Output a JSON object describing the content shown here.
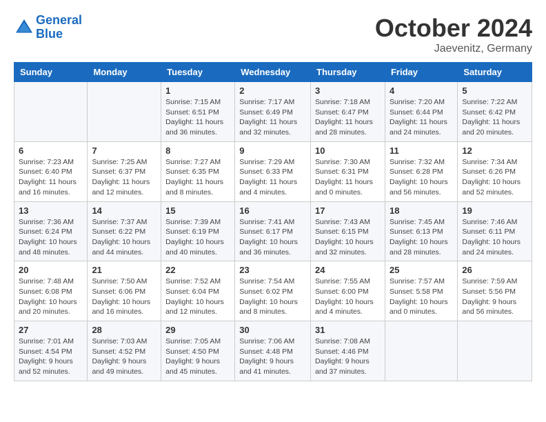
{
  "header": {
    "logo_line1": "General",
    "logo_line2": "Blue",
    "month": "October 2024",
    "location": "Jaevenitz, Germany"
  },
  "weekdays": [
    "Sunday",
    "Monday",
    "Tuesday",
    "Wednesday",
    "Thursday",
    "Friday",
    "Saturday"
  ],
  "weeks": [
    [
      {
        "day": "",
        "sunrise": "",
        "sunset": "",
        "daylight": ""
      },
      {
        "day": "",
        "sunrise": "",
        "sunset": "",
        "daylight": ""
      },
      {
        "day": "1",
        "sunrise": "Sunrise: 7:15 AM",
        "sunset": "Sunset: 6:51 PM",
        "daylight": "Daylight: 11 hours and 36 minutes."
      },
      {
        "day": "2",
        "sunrise": "Sunrise: 7:17 AM",
        "sunset": "Sunset: 6:49 PM",
        "daylight": "Daylight: 11 hours and 32 minutes."
      },
      {
        "day": "3",
        "sunrise": "Sunrise: 7:18 AM",
        "sunset": "Sunset: 6:47 PM",
        "daylight": "Daylight: 11 hours and 28 minutes."
      },
      {
        "day": "4",
        "sunrise": "Sunrise: 7:20 AM",
        "sunset": "Sunset: 6:44 PM",
        "daylight": "Daylight: 11 hours and 24 minutes."
      },
      {
        "day": "5",
        "sunrise": "Sunrise: 7:22 AM",
        "sunset": "Sunset: 6:42 PM",
        "daylight": "Daylight: 11 hours and 20 minutes."
      }
    ],
    [
      {
        "day": "6",
        "sunrise": "Sunrise: 7:23 AM",
        "sunset": "Sunset: 6:40 PM",
        "daylight": "Daylight: 11 hours and 16 minutes."
      },
      {
        "day": "7",
        "sunrise": "Sunrise: 7:25 AM",
        "sunset": "Sunset: 6:37 PM",
        "daylight": "Daylight: 11 hours and 12 minutes."
      },
      {
        "day": "8",
        "sunrise": "Sunrise: 7:27 AM",
        "sunset": "Sunset: 6:35 PM",
        "daylight": "Daylight: 11 hours and 8 minutes."
      },
      {
        "day": "9",
        "sunrise": "Sunrise: 7:29 AM",
        "sunset": "Sunset: 6:33 PM",
        "daylight": "Daylight: 11 hours and 4 minutes."
      },
      {
        "day": "10",
        "sunrise": "Sunrise: 7:30 AM",
        "sunset": "Sunset: 6:31 PM",
        "daylight": "Daylight: 11 hours and 0 minutes."
      },
      {
        "day": "11",
        "sunrise": "Sunrise: 7:32 AM",
        "sunset": "Sunset: 6:28 PM",
        "daylight": "Daylight: 10 hours and 56 minutes."
      },
      {
        "day": "12",
        "sunrise": "Sunrise: 7:34 AM",
        "sunset": "Sunset: 6:26 PM",
        "daylight": "Daylight: 10 hours and 52 minutes."
      }
    ],
    [
      {
        "day": "13",
        "sunrise": "Sunrise: 7:36 AM",
        "sunset": "Sunset: 6:24 PM",
        "daylight": "Daylight: 10 hours and 48 minutes."
      },
      {
        "day": "14",
        "sunrise": "Sunrise: 7:37 AM",
        "sunset": "Sunset: 6:22 PM",
        "daylight": "Daylight: 10 hours and 44 minutes."
      },
      {
        "day": "15",
        "sunrise": "Sunrise: 7:39 AM",
        "sunset": "Sunset: 6:19 PM",
        "daylight": "Daylight: 10 hours and 40 minutes."
      },
      {
        "day": "16",
        "sunrise": "Sunrise: 7:41 AM",
        "sunset": "Sunset: 6:17 PM",
        "daylight": "Daylight: 10 hours and 36 minutes."
      },
      {
        "day": "17",
        "sunrise": "Sunrise: 7:43 AM",
        "sunset": "Sunset: 6:15 PM",
        "daylight": "Daylight: 10 hours and 32 minutes."
      },
      {
        "day": "18",
        "sunrise": "Sunrise: 7:45 AM",
        "sunset": "Sunset: 6:13 PM",
        "daylight": "Daylight: 10 hours and 28 minutes."
      },
      {
        "day": "19",
        "sunrise": "Sunrise: 7:46 AM",
        "sunset": "Sunset: 6:11 PM",
        "daylight": "Daylight: 10 hours and 24 minutes."
      }
    ],
    [
      {
        "day": "20",
        "sunrise": "Sunrise: 7:48 AM",
        "sunset": "Sunset: 6:08 PM",
        "daylight": "Daylight: 10 hours and 20 minutes."
      },
      {
        "day": "21",
        "sunrise": "Sunrise: 7:50 AM",
        "sunset": "Sunset: 6:06 PM",
        "daylight": "Daylight: 10 hours and 16 minutes."
      },
      {
        "day": "22",
        "sunrise": "Sunrise: 7:52 AM",
        "sunset": "Sunset: 6:04 PM",
        "daylight": "Daylight: 10 hours and 12 minutes."
      },
      {
        "day": "23",
        "sunrise": "Sunrise: 7:54 AM",
        "sunset": "Sunset: 6:02 PM",
        "daylight": "Daylight: 10 hours and 8 minutes."
      },
      {
        "day": "24",
        "sunrise": "Sunrise: 7:55 AM",
        "sunset": "Sunset: 6:00 PM",
        "daylight": "Daylight: 10 hours and 4 minutes."
      },
      {
        "day": "25",
        "sunrise": "Sunrise: 7:57 AM",
        "sunset": "Sunset: 5:58 PM",
        "daylight": "Daylight: 10 hours and 0 minutes."
      },
      {
        "day": "26",
        "sunrise": "Sunrise: 7:59 AM",
        "sunset": "Sunset: 5:56 PM",
        "daylight": "Daylight: 9 hours and 56 minutes."
      }
    ],
    [
      {
        "day": "27",
        "sunrise": "Sunrise: 7:01 AM",
        "sunset": "Sunset: 4:54 PM",
        "daylight": "Daylight: 9 hours and 52 minutes."
      },
      {
        "day": "28",
        "sunrise": "Sunrise: 7:03 AM",
        "sunset": "Sunset: 4:52 PM",
        "daylight": "Daylight: 9 hours and 49 minutes."
      },
      {
        "day": "29",
        "sunrise": "Sunrise: 7:05 AM",
        "sunset": "Sunset: 4:50 PM",
        "daylight": "Daylight: 9 hours and 45 minutes."
      },
      {
        "day": "30",
        "sunrise": "Sunrise: 7:06 AM",
        "sunset": "Sunset: 4:48 PM",
        "daylight": "Daylight: 9 hours and 41 minutes."
      },
      {
        "day": "31",
        "sunrise": "Sunrise: 7:08 AM",
        "sunset": "Sunset: 4:46 PM",
        "daylight": "Daylight: 9 hours and 37 minutes."
      },
      {
        "day": "",
        "sunrise": "",
        "sunset": "",
        "daylight": ""
      },
      {
        "day": "",
        "sunrise": "",
        "sunset": "",
        "daylight": ""
      }
    ]
  ]
}
